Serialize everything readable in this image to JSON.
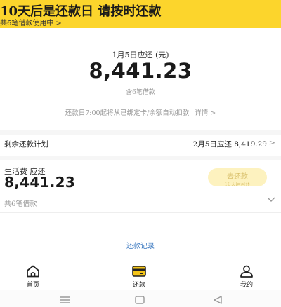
{
  "banner": {
    "title": "10天后是还款日 请按时还款",
    "subtitle": "共6笔借款使用中",
    "subtitle_chevron": ">",
    "color": "#fcd52c"
  },
  "summary": {
    "due_label": "1月5日应还 (元)",
    "amount": "8,441.23",
    "loan_count": "含6笔借款",
    "notice": "还款日7:00起将从已绑定卡/余额自动扣款",
    "detail_link": "详情 >"
  },
  "plan": {
    "label": "剩余还款计划",
    "next_due": "2月5日应还 8,419.29",
    "chevron": ">"
  },
  "category": {
    "label": "生活费 应还",
    "amount": "8,441.23",
    "pay_button": "去还款",
    "pay_button_sub": "10天后可还",
    "loan_count": "共6笔借款",
    "expand_icon": "chevron-down-icon"
  },
  "history_link": "还款记录",
  "tabs": [
    {
      "label": "首页",
      "icon": "home-icon"
    },
    {
      "label": "还款",
      "icon": "card-icon"
    },
    {
      "label": "我的",
      "icon": "person-icon"
    }
  ],
  "colors": {
    "accent": "#fcd52c",
    "link": "#3a78c0",
    "disabled_button": "#fdf2bf"
  }
}
